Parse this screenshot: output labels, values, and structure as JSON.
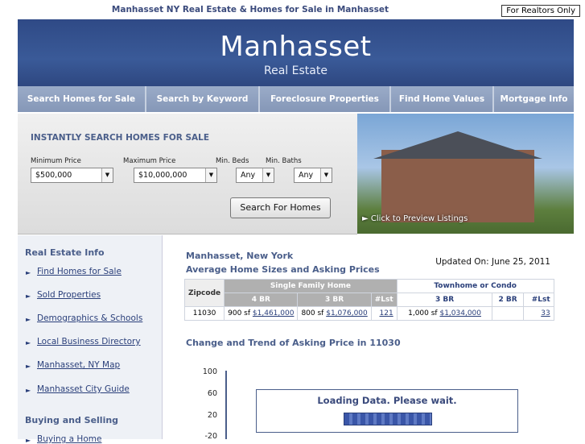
{
  "top": {
    "title": "Manhasset NY Real Estate & Homes for Sale in Manhasset",
    "realtors_button": "For Realtors Only"
  },
  "banner": {
    "name": "Manhasset",
    "subtitle": "Real Estate"
  },
  "nav": [
    {
      "label": "Search Homes for Sale"
    },
    {
      "label": "Search by Keyword"
    },
    {
      "label": "Foreclosure Properties"
    },
    {
      "label": "Find Home Values"
    },
    {
      "label": "Mortgage Info"
    }
  ],
  "search": {
    "heading": "INSTANTLY SEARCH HOMES FOR SALE",
    "min_price_label": "Minimum Price",
    "min_price_value": "$500,000",
    "max_price_label": "Maximum Price",
    "max_price_value": "$10,000,000",
    "beds_label": "Min. Beds",
    "beds_value": "Any",
    "baths_label": "Min. Baths",
    "baths_value": "Any",
    "button": "Search For Homes"
  },
  "photo": {
    "caption": "Click to Preview Listings"
  },
  "sidebar": {
    "section1": "Real Estate Info",
    "links": [
      "Find Homes for Sale",
      "Sold Properties",
      "Demographics & Schools",
      "Local Business Directory",
      "Manhasset, NY Map",
      "Manhasset City Guide"
    ],
    "section2": "Buying and Selling",
    "link_partial": "Buying a Home"
  },
  "main": {
    "city": "Manhasset, New York",
    "subtitle": "Average Home Sizes and Asking Prices",
    "updated": "Updated On: June 25, 2011",
    "table": {
      "zip_header": "Zipcode",
      "group1": "Single Family Home",
      "group2": "Townhome or Condo",
      "sub": [
        "4 BR",
        "3 BR",
        "#Lst",
        "3 BR",
        "2 BR",
        "#Lst"
      ],
      "row": {
        "zip": "11030",
        "c1_sf": "900 sf",
        "c1_price": "$1,461,000",
        "c2_sf": "800 sf",
        "c2_price": "$1,076,000",
        "c3": "121",
        "c4_sf": "1,000 sf",
        "c4_price": "$1,034,000",
        "c5": "",
        "c6": "33"
      }
    },
    "trend_title": "Change and Trend of Asking Price in 11030",
    "ticks": [
      "100",
      "60",
      "20",
      "-20"
    ],
    "loading": "Loading Data. Please wait."
  }
}
